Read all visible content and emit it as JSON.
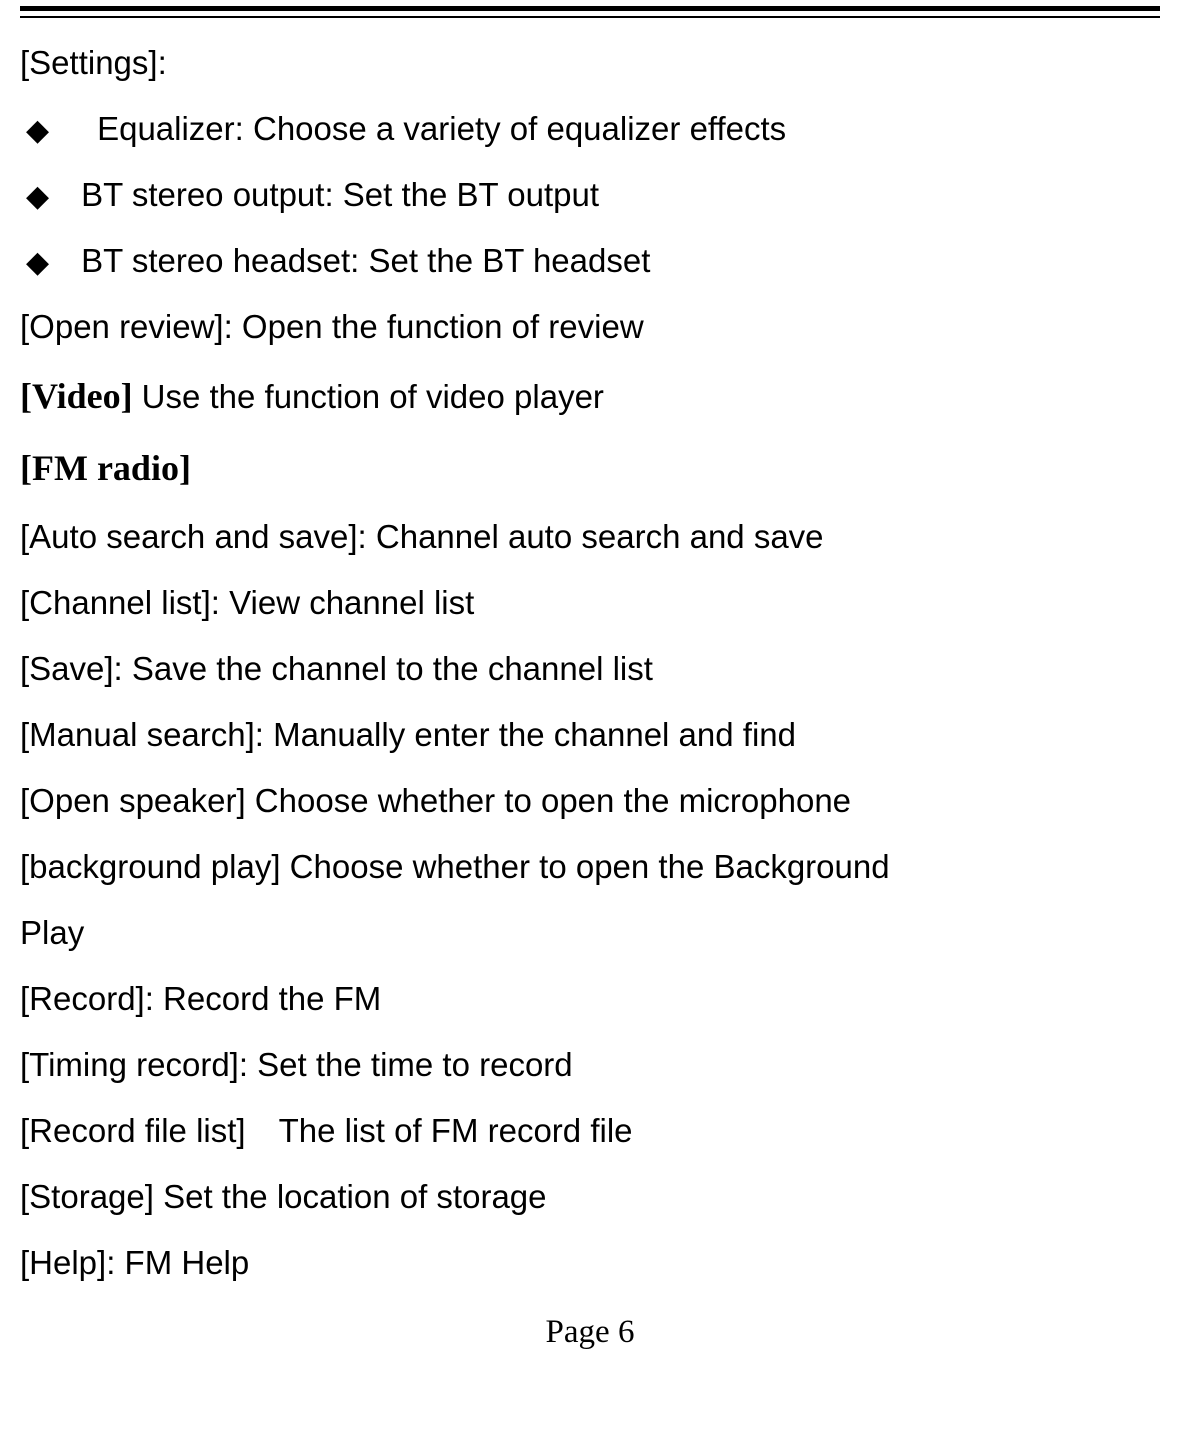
{
  "settings_heading": "[Settings]:",
  "bullets": {
    "equalizer": "Equalizer: Choose a variety of equalizer effects",
    "bt_output": "BT stereo output: Set the BT output",
    "bt_headset": "BT stereo headset: Set the BT headset"
  },
  "open_review": "[Open review]: Open the function of review",
  "video_bold": "[Video] ",
  "video_rest": "Use the function of video player",
  "fm_radio_heading": "[FM radio]",
  "fm": {
    "auto_search": "[Auto search and save]: Channel auto search and save",
    "channel_list": "[Channel list]: View channel list",
    "save": "[Save]: Save the channel to the channel list",
    "manual_search": "[Manual search]: Manually enter the channel and find",
    "open_speaker": "[Open speaker] Choose whether to open the microphone",
    "background_play_1": "[background play] Choose whether to open the Background",
    "background_play_2": "Play",
    "record": "[Record]: Record the FM",
    "timing_record": "[Timing record]: Set the time to record",
    "record_file_list": "[Record file list] The list of FM record file",
    "storage": "[Storage] Set the location of storage",
    "help": "[Help]: FM Help"
  },
  "page_number": "Page 6",
  "diamond_glyph": "◆"
}
